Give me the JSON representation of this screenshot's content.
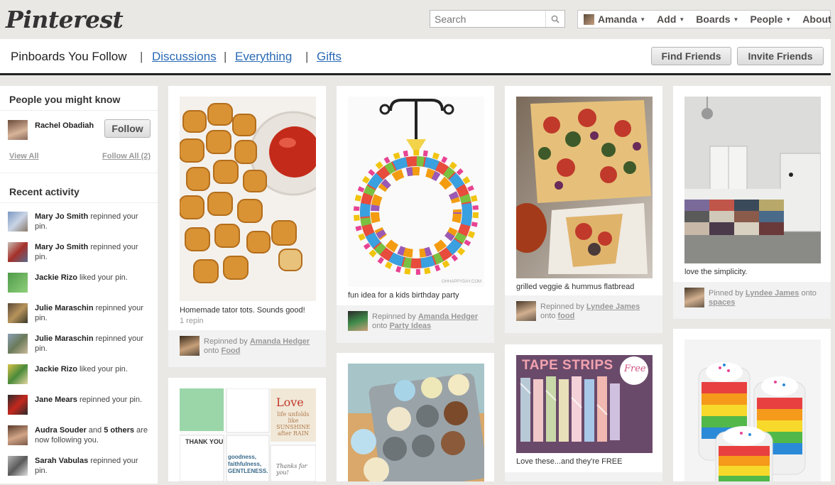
{
  "logo": "Pinterest",
  "search": {
    "placeholder": "Search",
    "icon": "magnifier-icon"
  },
  "topnav": {
    "user": "Amanda",
    "add": "Add",
    "boards": "Boards",
    "people": "People",
    "about": "About"
  },
  "subnav": {
    "current": "Pinboards You Follow",
    "links": [
      "Discussions",
      "Everything",
      "Gifts"
    ],
    "find_friends": "Find Friends",
    "invite_friends": "Invite Friends"
  },
  "sidebar": {
    "people_title": "People you might know",
    "suggestion_name": "Rachel Obadiah",
    "follow": "Follow",
    "view_all": "View All",
    "follow_all": "Follow All (2)",
    "activity_title": "Recent activity",
    "activity": [
      {
        "name": "Mary Jo Smith",
        "text": " repinned your pin."
      },
      {
        "name": "Mary Jo Smith",
        "text": " repinned your pin."
      },
      {
        "name": "Jackie Rizo",
        "text": " liked your pin."
      },
      {
        "name": "Julie Maraschin",
        "text": " repinned your pin."
      },
      {
        "name": "Julie Maraschin",
        "text": " repinned your pin."
      },
      {
        "name": "Jackie Rizo",
        "text": " liked your pin."
      },
      {
        "name": "Jane Mears",
        "text": " repinned your pin."
      },
      {
        "name": "Audra Souder",
        "text": " and ",
        "extra": "5 others",
        "text2": " are now following you."
      },
      {
        "name": "Sarah Vabulas",
        "text": " repinned your pin."
      }
    ]
  },
  "pins": {
    "p1": {
      "desc": "Homemade tator tots. Sounds good!",
      "repins": "1 repin",
      "via": "Repinned by ",
      "user": "Amanda Hedger",
      "onto": "onto ",
      "board": "Food"
    },
    "p2": {
      "desc": "fun idea for a kids birthday party",
      "via": "Repinned by ",
      "user": "Amanda Hedger",
      "onto": "onto ",
      "board": "Party Ideas",
      "img_watermark": "OHHAPPYDAY.COM"
    },
    "p3": {
      "desc": "grilled veggie & hummus flatbread",
      "via": "Repinned by ",
      "user": "Lyndee James",
      "onto": "onto ",
      "board": "food"
    },
    "p4": {
      "desc": "love the simplicity.",
      "via": "Pinned by ",
      "user": "Lyndee James",
      "onto": "onto ",
      "board": "spaces"
    },
    "p5": {
      "poster_title": "TAPE STRIPS",
      "poster_badge": "Free",
      "desc": "Love these...and they're FREE"
    },
    "p6": {
      "cards": [
        "Love",
        "life unfolds like SUNSHINE after RAIN",
        "THANK YOU",
        "goodness, faithfulness, GENTLENESS.",
        "Thanks for you!"
      ]
    }
  },
  "colors": {
    "background": "#e9e8e5",
    "link": "#2a6ab4",
    "text": "#333333"
  }
}
